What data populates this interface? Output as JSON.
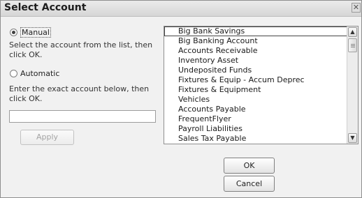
{
  "dialog": {
    "title": "Select Account",
    "close_icon": "close-icon"
  },
  "manual": {
    "label": "Manual",
    "selected": true,
    "instruction": "Select the account from the list, then click OK."
  },
  "automatic": {
    "label": "Automatic",
    "selected": false,
    "instruction": "Enter the exact account below, then click OK.",
    "input_value": "",
    "apply_label": "Apply"
  },
  "accounts": {
    "items": [
      "Big Bank Savings",
      "Big Banking Account",
      "Accounts Receivable",
      "Inventory Asset",
      "Undeposited Funds",
      "Fixtures & Equip - Accum Deprec",
      "Fixtures & Equipment",
      "Vehicles",
      "Accounts Payable",
      "FrequentFlyer",
      "Payroll Liabilities",
      "Sales Tax Payable"
    ],
    "selected_index": 0
  },
  "buttons": {
    "ok_label": "OK",
    "cancel_label": "Cancel"
  }
}
